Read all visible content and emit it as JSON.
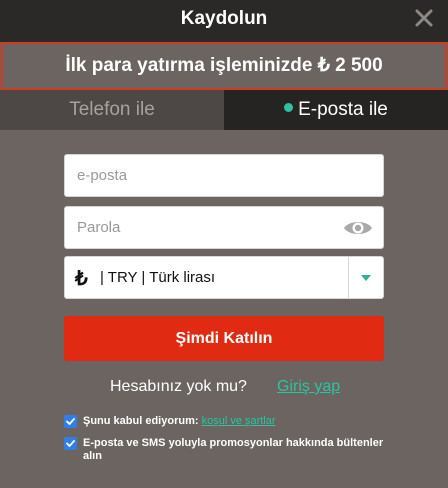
{
  "header": {
    "title": "Kaydolun",
    "close_icon": "close-icon"
  },
  "promo": {
    "text": "İlk para yatırma işleminizde ₺ 2 500"
  },
  "tabs": [
    {
      "label": "Telefon ile",
      "active": false
    },
    {
      "label": "E-posta ile",
      "active": true
    }
  ],
  "form": {
    "email_placeholder": "e-posta",
    "email_value": "",
    "password_placeholder": "Parola",
    "password_value": "",
    "eye_icon": "eye-icon",
    "currency": {
      "symbol": "₺",
      "label": "| TRY | Türk lirası"
    },
    "submit_label": "Şimdi Katılın"
  },
  "login": {
    "question": "Hesabınız yok mu?",
    "link": "Giriş yap"
  },
  "checkboxes": [
    {
      "label": "Şunu kabul ediyorum:",
      "link": "koşul ve şartlar",
      "checked": true
    },
    {
      "label": "E-posta ve SMS yoluyla promosyonlar hakkında bültenler alın",
      "checked": true
    }
  ],
  "colors": {
    "accent": "#2bc4a1",
    "button": "#e02a12",
    "promo_border": "#cf3a22",
    "background": "#6b6460",
    "header": "#2b2927",
    "checkbox": "#2f7fe6"
  }
}
